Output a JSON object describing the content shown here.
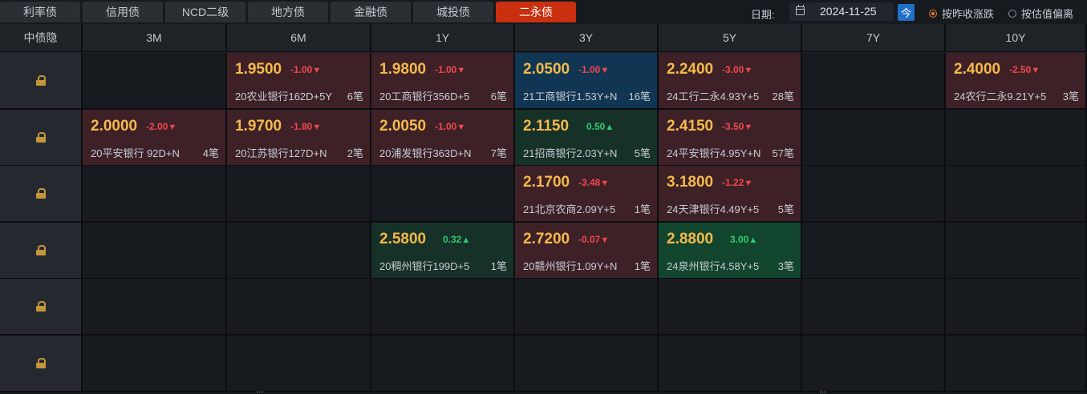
{
  "tabs": [
    "利率债",
    "信用债",
    "NCD二级",
    "地方债",
    "金融债",
    "城投债",
    "二永债"
  ],
  "active_tab": 6,
  "date_label": "日期:",
  "date_value": "2024-11-25",
  "today_label": "今",
  "radio_options": [
    "按昨收涨跌",
    "按估值偏离"
  ],
  "radio_selected": 0,
  "row_header": "中债隐",
  "columns": [
    "3M",
    "6M",
    "1Y",
    "3Y",
    "5Y",
    "7Y",
    "10Y"
  ],
  "icon_lock": "lock-icon",
  "colors": {
    "active_tab": "#c9300f",
    "yield": "#f6b94b",
    "down": "#f0474f",
    "up": "#2fca72",
    "cell_down": "#3d2127",
    "cell_up": "#163128",
    "cell_up_strong": "#11452e",
    "cell_blue": "#103653"
  },
  "rows": [
    {
      "cells": [
        null,
        {
          "yield": "1.9500",
          "change": "-1.00",
          "dir": "down",
          "style": "down",
          "name": "20农业银行162D+5Y",
          "count": "6笔"
        },
        {
          "yield": "1.9800",
          "change": "-1.00",
          "dir": "down",
          "style": "down",
          "name": "20工商银行356D+5",
          "count": "6笔"
        },
        {
          "yield": "2.0500",
          "change": "-1.00",
          "dir": "down",
          "style": "blue",
          "name": "21工商银行1.53Y+N",
          "count": "16笔"
        },
        {
          "yield": "2.2400",
          "change": "-3.00",
          "dir": "down",
          "style": "down",
          "name": "24工行二永4.93Y+5",
          "count": "28笔"
        },
        null,
        {
          "yield": "2.4000",
          "change": "-2.50",
          "dir": "down",
          "style": "down",
          "name": "24农行二永9.21Y+5",
          "count": "3笔"
        }
      ]
    },
    {
      "cells": [
        {
          "yield": "2.0000",
          "change": "-2.00",
          "dir": "down",
          "style": "down",
          "name": "20平安银行 92D+N",
          "count": "4笔"
        },
        {
          "yield": "1.9700",
          "change": "-1.80",
          "dir": "down",
          "style": "down",
          "name": "20江苏银行127D+N",
          "count": "2笔"
        },
        {
          "yield": "2.0050",
          "change": "-1.00",
          "dir": "down",
          "style": "down",
          "name": "20浦发银行363D+N",
          "count": "7笔"
        },
        {
          "yield": "2.1150",
          "change": "0.50",
          "dir": "up",
          "style": "up",
          "name": "21招商银行2.03Y+N",
          "count": "5笔"
        },
        {
          "yield": "2.4150",
          "change": "-3.50",
          "dir": "down",
          "style": "down",
          "name": "24平安银行4.95Y+N",
          "count": "57笔"
        },
        null,
        null
      ]
    },
    {
      "cells": [
        null,
        null,
        null,
        {
          "yield": "2.1700",
          "change": "-3.48",
          "dir": "down",
          "style": "down",
          "name": "21北京农商2.09Y+5",
          "count": "1笔"
        },
        {
          "yield": "3.1800",
          "change": "-1.22",
          "dir": "down",
          "style": "down",
          "name": "24天津银行4.49Y+5",
          "count": "5笔"
        },
        null,
        null
      ]
    },
    {
      "cells": [
        null,
        null,
        {
          "yield": "2.5800",
          "change": "0.32",
          "dir": "up",
          "style": "up",
          "name": "20稠州银行199D+5",
          "count": "1笔"
        },
        {
          "yield": "2.7200",
          "change": "-0.07",
          "dir": "down",
          "style": "down",
          "name": "20赣州银行1.09Y+N",
          "count": "1笔"
        },
        {
          "yield": "2.8800",
          "change": "3.00",
          "dir": "up",
          "style": "up2",
          "name": "24泉州银行4.58Y+5",
          "count": "3笔"
        },
        null,
        null
      ]
    },
    {
      "cells": [
        null,
        null,
        null,
        null,
        null,
        null,
        null
      ]
    },
    {
      "cells": [
        null,
        null,
        null,
        null,
        null,
        null,
        null
      ]
    }
  ]
}
